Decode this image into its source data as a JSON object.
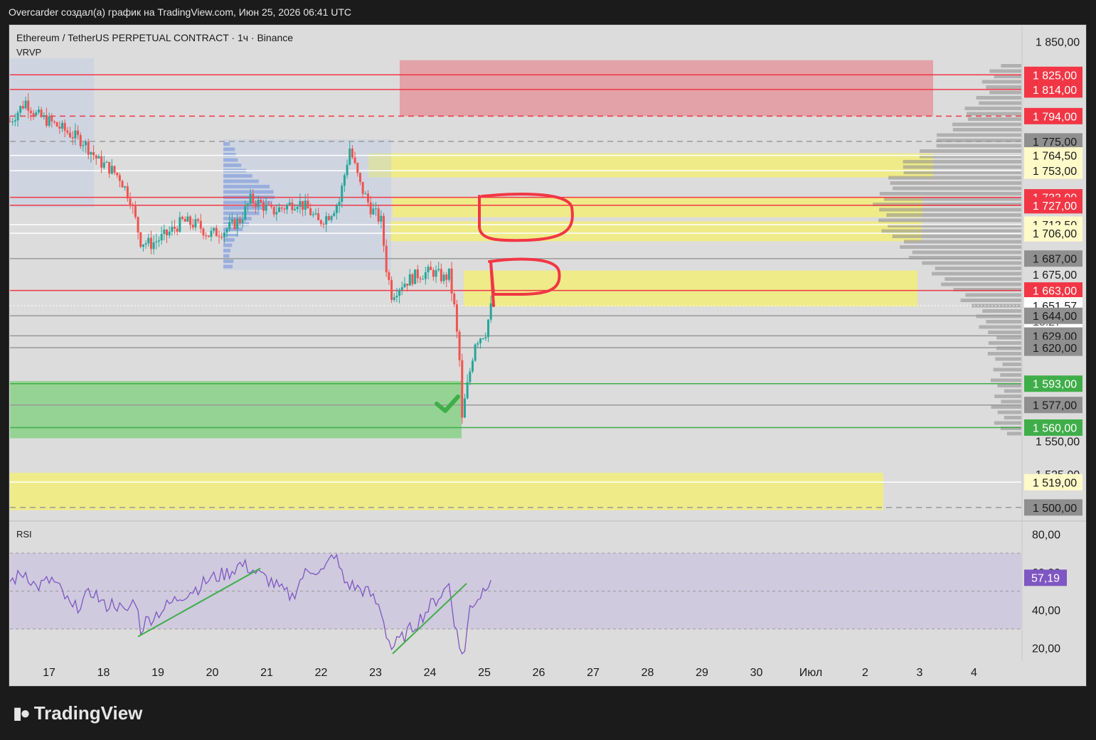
{
  "caption": "Overcarder создал(а) график на TradingView.com, Июн 25, 2026 06:41 UTC",
  "symbol_line": "Ethereum / TetherUS PERPETUAL CONTRACT · 1ч · Binance",
  "indicator_label": "VRVP",
  "rsi_label": "RSI",
  "brand": {
    "logo_icon": "tradingview-logo-icon",
    "name": "TradingView"
  },
  "colors": {
    "bg": "#dcdcdc",
    "red": "#f23645",
    "green": "#3fae49",
    "yellow": "#f0ec88",
    "rsi": "#7e57c2",
    "candle_up": "#26a69a",
    "candle_down": "#ef5350"
  },
  "chart_data": [
    {
      "type": "candlestick",
      "axis": {
        "price_ticks": [
          "1 850,00",
          "1 550,00",
          "1 525,00"
        ],
        "ylim": [
          1493,
          1862
        ]
      },
      "x_labels": [
        "17",
        "18",
        "19",
        "20",
        "21",
        "22",
        "23",
        "24",
        "25",
        "26",
        "27",
        "28",
        "29",
        "30",
        "Июл",
        "2",
        "3",
        "4"
      ],
      "price_tags": [
        {
          "value": 1825.0,
          "label": "1 825,00",
          "style": "red"
        },
        {
          "value": 1814.0,
          "label": "1 814,00",
          "style": "red"
        },
        {
          "value": 1794.0,
          "label": "1 794,00",
          "style": "red"
        },
        {
          "value": 1775.0,
          "label": "1 775,00",
          "style": "gray"
        },
        {
          "value": 1764.5,
          "label": "1 764,50",
          "style": "yellow"
        },
        {
          "value": 1753.0,
          "label": "1 753,00",
          "style": "yellow"
        },
        {
          "value": 1733.0,
          "label": "1 733,00",
          "style": "red"
        },
        {
          "value": 1727.0,
          "label": "1 727,00",
          "style": "red"
        },
        {
          "value": 1712.5,
          "label": "1 712,50",
          "style": "yellow"
        },
        {
          "value": 1706.0,
          "label": "1 706,00",
          "style": "yellow"
        },
        {
          "value": 1687.0,
          "label": "1 687,00",
          "style": "gray"
        },
        {
          "value": 1675.0,
          "label": "1 675,00",
          "style": "plain"
        },
        {
          "value": 1663.0,
          "label": "1 663,00",
          "style": "red"
        },
        {
          "value": 1651.57,
          "label": "1 651,57",
          "style": "current",
          "countdown": "18:27"
        },
        {
          "value": 1644.0,
          "label": "1 644,00",
          "style": "gray"
        },
        {
          "value": 1629.0,
          "label": "1 629,00",
          "style": "gray"
        },
        {
          "value": 1620.0,
          "label": "1 620,00",
          "style": "gray"
        },
        {
          "value": 1593.0,
          "label": "1 593,00",
          "style": "green"
        },
        {
          "value": 1577.0,
          "label": "1 577,00",
          "style": "gray"
        },
        {
          "value": 1560.0,
          "label": "1 560,00",
          "style": "green"
        },
        {
          "value": 1519.0,
          "label": "1 519,00",
          "style": "yellow"
        },
        {
          "value": 1500.0,
          "label": "1 500,00",
          "style": "gray"
        }
      ],
      "zones": [
        {
          "kind": "supply",
          "color": "red",
          "from": 1794,
          "to": 1836
        },
        {
          "kind": "zone",
          "color": "yellow",
          "from": 1748,
          "to": 1766
        },
        {
          "kind": "zone",
          "color": "yellow",
          "from": 1718,
          "to": 1733
        },
        {
          "kind": "zone",
          "color": "yellow",
          "from": 1700,
          "to": 1715
        },
        {
          "kind": "zone",
          "color": "yellow",
          "from": 1651,
          "to": 1678
        },
        {
          "kind": "demand",
          "color": "green",
          "from": 1552,
          "to": 1595
        },
        {
          "kind": "zone",
          "color": "yellow",
          "from": 1498,
          "to": 1526
        }
      ],
      "path": [
        [
          0,
          1790
        ],
        [
          3,
          1805
        ],
        [
          5,
          1795
        ],
        [
          8,
          1789
        ],
        [
          11,
          1782
        ],
        [
          14,
          1775
        ],
        [
          17,
          1760
        ],
        [
          19,
          1755
        ],
        [
          21,
          1748
        ],
        [
          23,
          1732
        ],
        [
          25,
          1700
        ],
        [
          27,
          1698
        ],
        [
          30,
          1705
        ],
        [
          33,
          1715
        ],
        [
          36,
          1712
        ],
        [
          38,
          1705
        ],
        [
          41,
          1708
        ],
        [
          44,
          1716
        ],
        [
          46,
          1731
        ],
        [
          48,
          1728
        ],
        [
          50,
          1722
        ],
        [
          52,
          1725
        ],
        [
          55,
          1730
        ],
        [
          57,
          1724
        ],
        [
          59,
          1714
        ],
        [
          61,
          1720
        ],
        [
          63,
          1730
        ],
        [
          65,
          1770
        ],
        [
          67,
          1742
        ],
        [
          69,
          1725
        ],
        [
          71,
          1715
        ],
        [
          72,
          1680
        ],
        [
          73,
          1660
        ],
        [
          75,
          1668
        ],
        [
          78,
          1675
        ],
        [
          81,
          1677
        ],
        [
          83,
          1672
        ],
        [
          84,
          1675
        ],
        [
          85,
          1650
        ],
        [
          86,
          1610
        ],
        [
          86.5,
          1565
        ],
        [
          87,
          1580
        ],
        [
          89,
          1625
        ],
        [
          91,
          1632
        ],
        [
          92,
          1650
        ]
      ]
    },
    {
      "type": "line",
      "title": "RSI",
      "axis": {
        "ticks": [
          "80,00",
          "60,00",
          "40,00",
          "20,00"
        ],
        "ylim": [
          15,
          85
        ]
      },
      "current": {
        "value": 57.19,
        "label": "57,19"
      },
      "path": [
        [
          0,
          55
        ],
        [
          3,
          60
        ],
        [
          5,
          52
        ],
        [
          8,
          56
        ],
        [
          10,
          49
        ],
        [
          12,
          40
        ],
        [
          14,
          45
        ],
        [
          16,
          50
        ],
        [
          18,
          42
        ],
        [
          20,
          44
        ],
        [
          22,
          38
        ],
        [
          24,
          46
        ],
        [
          25,
          30
        ],
        [
          26,
          34
        ],
        [
          30,
          42
        ],
        [
          33,
          48
        ],
        [
          36,
          52
        ],
        [
          38,
          56
        ],
        [
          40,
          58
        ],
        [
          42,
          60
        ],
        [
          44,
          64
        ],
        [
          46,
          62
        ],
        [
          48,
          58
        ],
        [
          50,
          55
        ],
        [
          52,
          50
        ],
        [
          54,
          47
        ],
        [
          56,
          58
        ],
        [
          58,
          62
        ],
        [
          60,
          60
        ],
        [
          62,
          70
        ],
        [
          64,
          55
        ],
        [
          66,
          52
        ],
        [
          68,
          50
        ],
        [
          69,
          48
        ],
        [
          71,
          40
        ],
        [
          72,
          28
        ],
        [
          73,
          20
        ],
        [
          75,
          25
        ],
        [
          78,
          34
        ],
        [
          81,
          44
        ],
        [
          83,
          50
        ],
        [
          84,
          54
        ],
        [
          85,
          35
        ],
        [
          86,
          20
        ],
        [
          87,
          18
        ],
        [
          88,
          42
        ],
        [
          90,
          48
        ],
        [
          92,
          58
        ]
      ]
    }
  ]
}
